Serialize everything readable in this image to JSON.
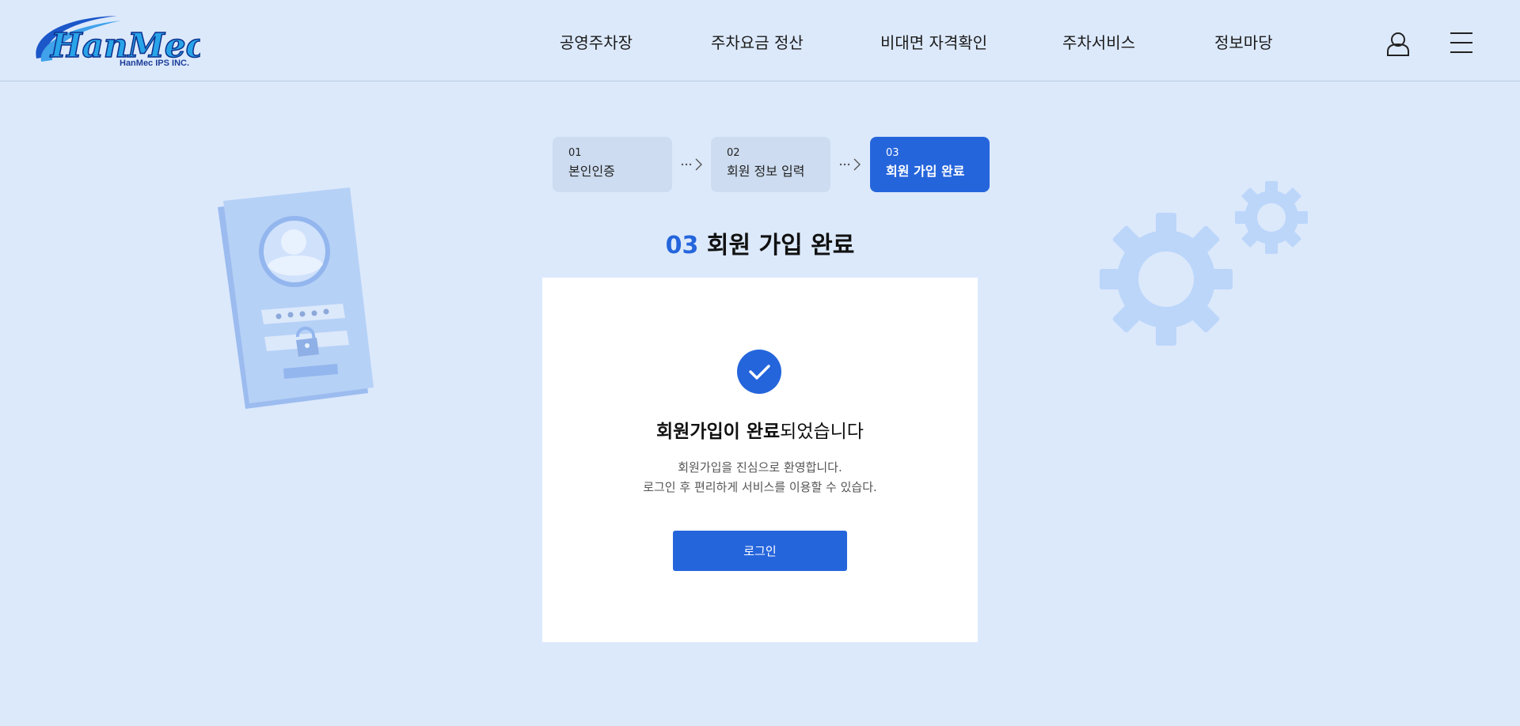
{
  "header": {
    "logo_text": "HanMec",
    "logo_subtext": "HanMec IPS INC.",
    "nav": [
      {
        "label": "공영주차장"
      },
      {
        "label": "주차요금 정산"
      },
      {
        "label": "비대면 자격확인"
      },
      {
        "label": "주차서비스"
      },
      {
        "label": "정보마당"
      }
    ],
    "user_icon": "user-icon",
    "menu_icon": "hamburger-menu-icon"
  },
  "steps": [
    {
      "num": "01",
      "label": "본인인증",
      "active": false
    },
    {
      "num": "02",
      "label": "회원 정보 입력",
      "active": false
    },
    {
      "num": "03",
      "label": "회원 가입 완료",
      "active": true
    }
  ],
  "heading": {
    "num": "03",
    "title": "회원 가입 완료"
  },
  "card": {
    "icon": "check-circle-icon",
    "title_bold": "회원가입이 완료",
    "title_rest": "되었습니다",
    "desc_line1": "회원가입을 진심으로 환영합니다.",
    "desc_line2": "로그인 후 편리하게 서비스를 이용할 수 있습다.",
    "login_label": "로그인"
  },
  "colors": {
    "background": "#dce9fb",
    "primary": "#2565dc",
    "step_inactive": "#cddcf0",
    "illustration": "#b6d1f6"
  }
}
